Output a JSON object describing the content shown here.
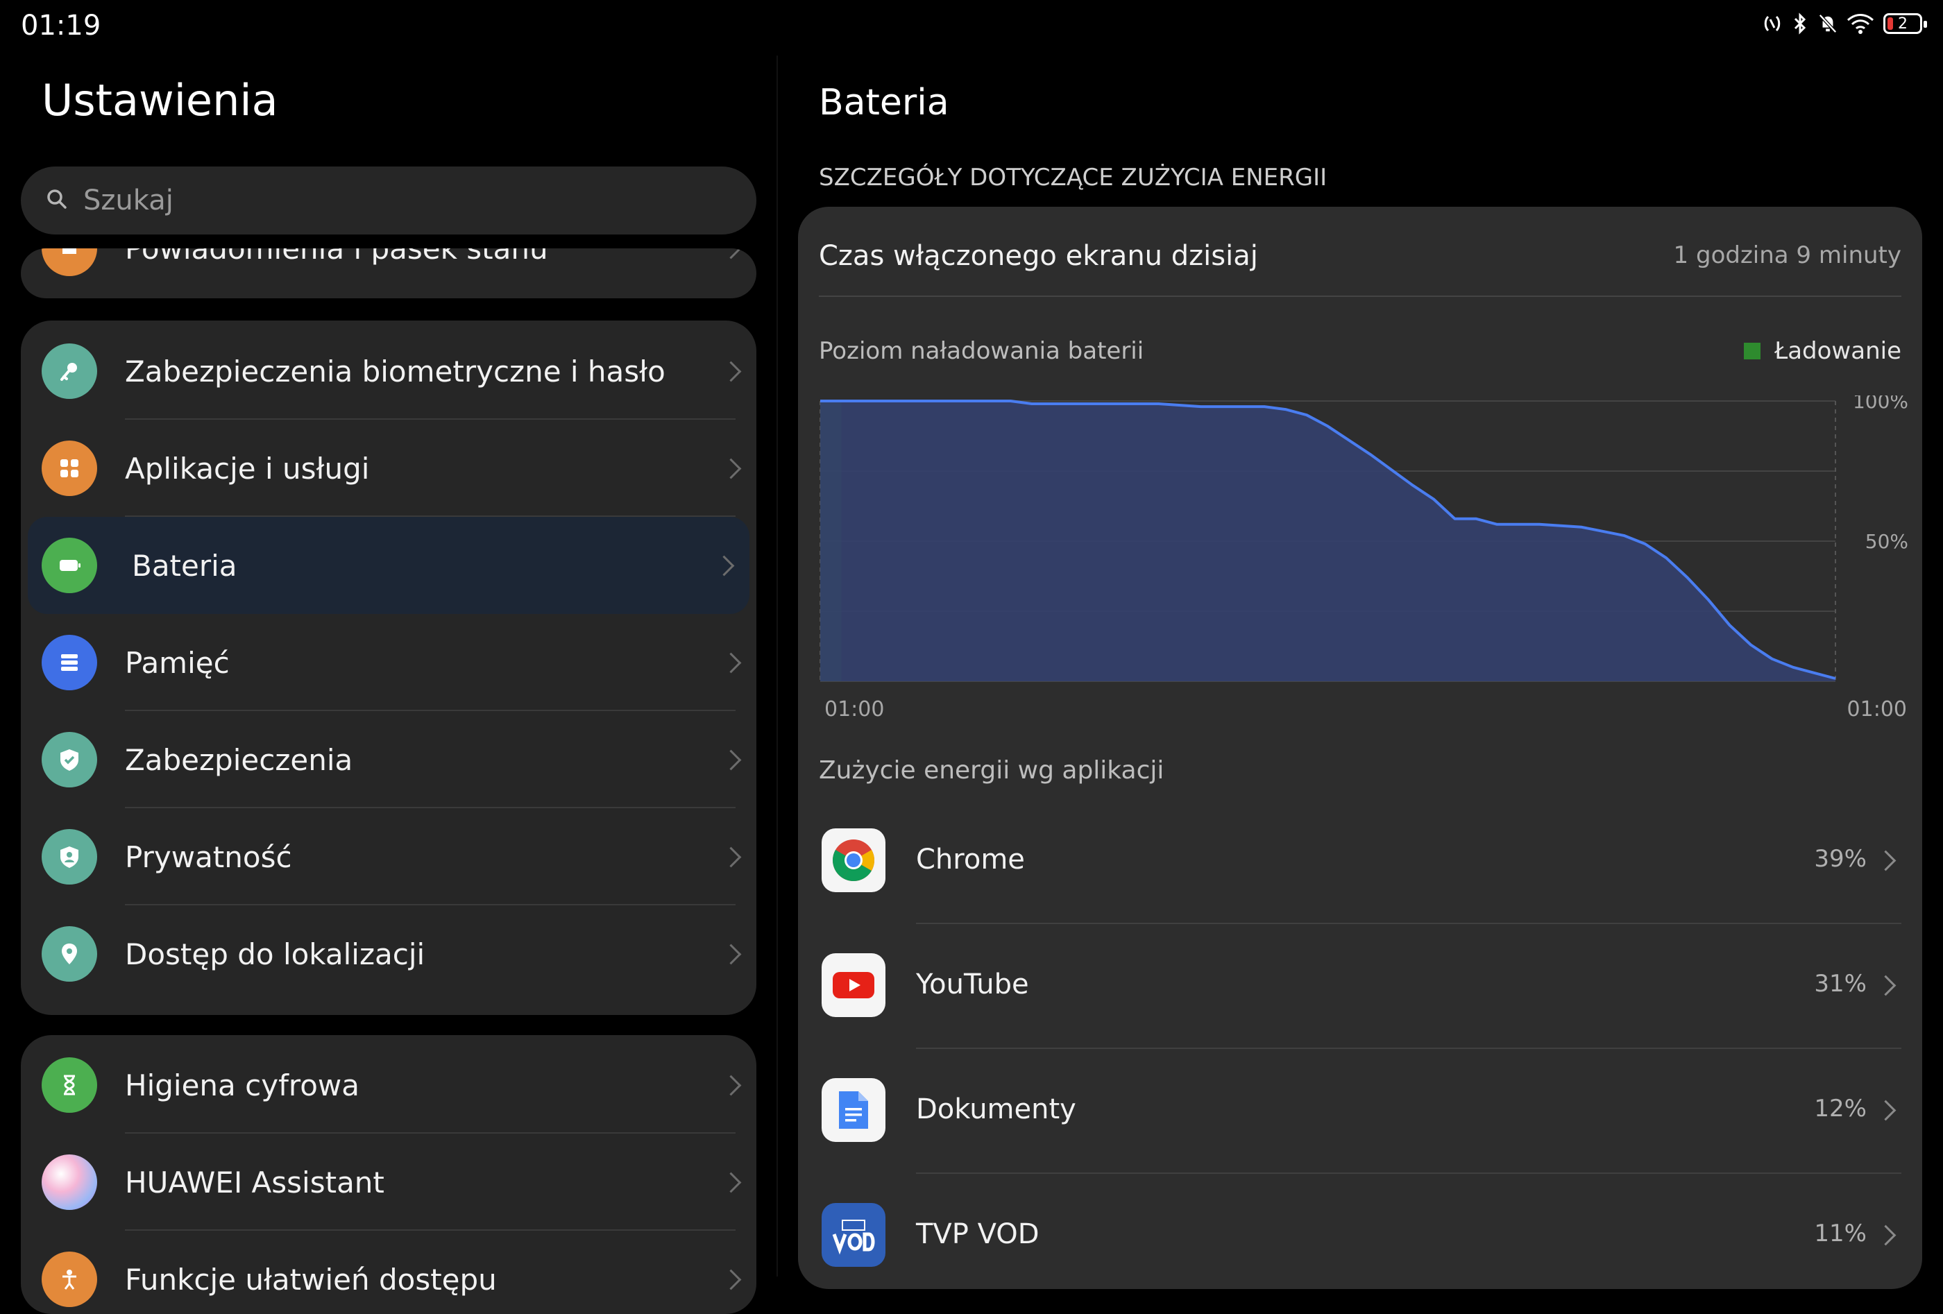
{
  "status_bar": {
    "time": "01:19",
    "battery_level": "2",
    "icons": [
      "nfc-icon",
      "bluetooth-icon",
      "bell-muted-icon",
      "wifi-icon",
      "battery-icon"
    ]
  },
  "left": {
    "title": "Ustawienia",
    "search_placeholder": "Szukaj",
    "partial_item": {
      "label": "Powiadomienia i pasek stanu",
      "icon": "bell-icon",
      "color": "#e3893a"
    },
    "group1": [
      {
        "label": "Zabezpieczenia biometryczne i hasło",
        "icon": "key-icon",
        "color": "#5fae9a"
      },
      {
        "label": "Aplikacje i usługi",
        "icon": "apps-icon",
        "color": "#e3893a"
      },
      {
        "label": "Bateria",
        "icon": "battery-icon",
        "color": "#4caf50",
        "selected": true
      },
      {
        "label": "Pamięć",
        "icon": "storage-icon",
        "color": "#3f6fe6"
      },
      {
        "label": "Zabezpieczenia",
        "icon": "shield-check-icon",
        "color": "#5fae9a"
      },
      {
        "label": "Prywatność",
        "icon": "privacy-shield-icon",
        "color": "#5fae9a"
      },
      {
        "label": "Dostęp do lokalizacji",
        "icon": "location-pin-icon",
        "color": "#5fae9a"
      }
    ],
    "group2": [
      {
        "label": "Higiena cyfrowa",
        "icon": "hourglass-icon",
        "color": "#4caf50"
      },
      {
        "label": "HUAWEI Assistant",
        "icon": "assistant-orb-icon",
        "color": "#c9a0e8"
      },
      {
        "label": "Funkcje ułatwień dostępu",
        "icon": "accessibility-icon",
        "color": "#e3893a"
      }
    ]
  },
  "right": {
    "title": "Bateria",
    "section_header": "SZCZEGÓŁY DOTYCZĄCE ZUŻYCIA ENERGII",
    "screen_time_label": "Czas włączonego ekranu dzisiaj",
    "screen_time_value": "1 godzina 9 minuty",
    "chart_title": "Poziom naładowania baterii",
    "legend_label": "Ładowanie",
    "apps_label": "Zużycie energii wg aplikacji",
    "apps": [
      {
        "name": "Chrome",
        "percent": "39%",
        "icon": "chrome-icon"
      },
      {
        "name": "YouTube",
        "percent": "31%",
        "icon": "youtube-icon"
      },
      {
        "name": "Dokumenty",
        "percent": "12%",
        "icon": "docs-icon"
      },
      {
        "name": "TVP VOD",
        "percent": "11%",
        "icon": "tvp-vod-icon"
      }
    ]
  },
  "chart_data": {
    "type": "area",
    "title": "Poziom naładowania baterii",
    "x_tick_labels": [
      "01:00",
      "01:00"
    ],
    "y_tick_labels": [
      "100%",
      "50%"
    ],
    "ylim": [
      0,
      100
    ],
    "xlim": [
      0,
      24
    ],
    "legend": [
      {
        "name": "Ładowanie",
        "color": "#2e8b2e"
      }
    ],
    "charging_interval": [
      0,
      0.5
    ],
    "line_color": "#4a7df0",
    "fill_color": "#34406e",
    "series": [
      {
        "x": [
          0,
          0.5,
          1,
          2,
          3,
          4,
          4.5,
          5,
          6,
          7,
          8,
          9,
          10,
          10.5,
          11,
          11.5,
          12,
          13,
          14,
          14.5,
          15,
          15.5,
          16,
          16.5,
          17,
          18,
          19,
          19.5,
          20,
          20.5,
          21,
          21.5,
          22,
          22.5,
          23,
          23.5,
          24
        ],
        "y": [
          100,
          100,
          100,
          100,
          100,
          100,
          100,
          99,
          99,
          99,
          99,
          98,
          98,
          98,
          97,
          95,
          91,
          81,
          70,
          65,
          58,
          58,
          56,
          56,
          56,
          55,
          52,
          49,
          44,
          37,
          29,
          20,
          13,
          8,
          5,
          3,
          1
        ]
      }
    ],
    "grid": true
  }
}
